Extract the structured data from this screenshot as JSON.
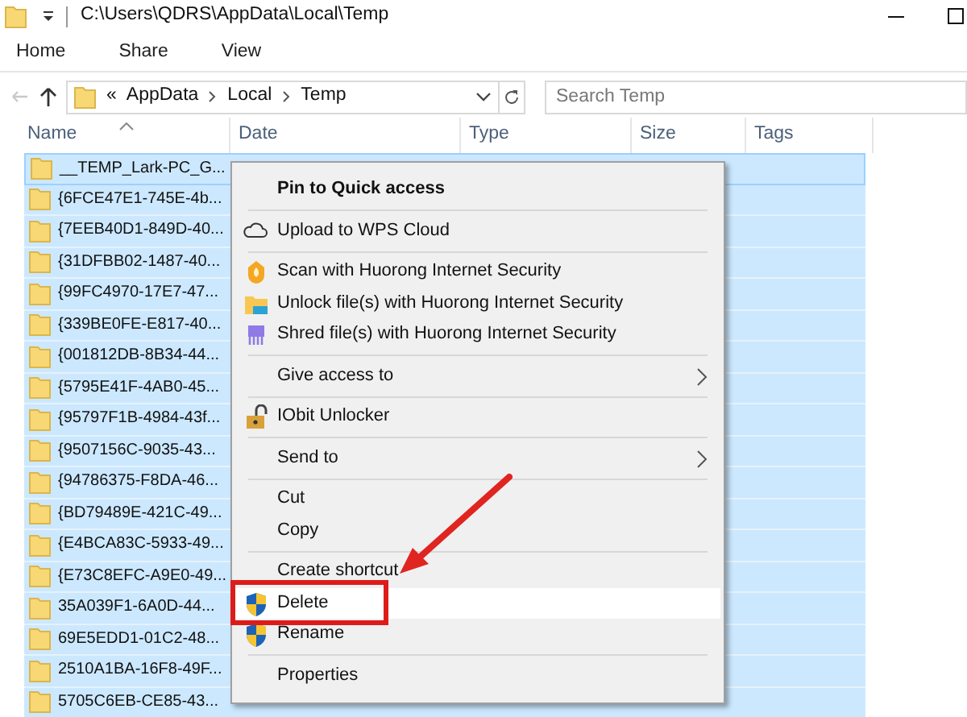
{
  "window": {
    "title": "C:\\Users\\QDRS\\AppData\\Local\\Temp"
  },
  "ribbon_tabs": [
    {
      "label": "Home"
    },
    {
      "label": "Share"
    },
    {
      "label": "View"
    }
  ],
  "address_bar": {
    "overflow": "«",
    "crumbs": [
      "AppData",
      "Local",
      "Temp"
    ]
  },
  "search": {
    "placeholder": "Search Temp"
  },
  "columns": [
    "Name",
    "Date",
    "Type",
    "Size",
    "Tags"
  ],
  "files": [
    {
      "name": "__TEMP_Lark-PC_G...",
      "selected": true
    },
    {
      "name": "{6FCE47E1-745E-4b...",
      "selected": true
    },
    {
      "name": "{7EEB40D1-849D-40...",
      "selected": true
    },
    {
      "name": "{31DFBB02-1487-40...",
      "selected": true
    },
    {
      "name": "{99FC4970-17E7-47...",
      "selected": true
    },
    {
      "name": "{339BE0FE-E817-40...",
      "selected": true
    },
    {
      "name": "{001812DB-8B34-44...",
      "selected": true
    },
    {
      "name": "{5795E41F-4AB0-45...",
      "selected": true
    },
    {
      "name": "{95797F1B-4984-43f...",
      "selected": true
    },
    {
      "name": "{9507156C-9035-43...",
      "selected": true
    },
    {
      "name": "{94786375-F8DA-46...",
      "selected": true
    },
    {
      "name": "{BD79489E-421C-49...",
      "selected": true
    },
    {
      "name": "{E4BCA83C-5933-49...",
      "selected": true
    },
    {
      "name": "{E73C8EFC-A9E0-49...",
      "selected": true
    },
    {
      "name": "35A039F1-6A0D-44...",
      "selected": true
    },
    {
      "name": "69E5EDD1-01C2-48...",
      "selected": true
    },
    {
      "name": "2510A1BA-16F8-49F...",
      "selected": true
    },
    {
      "name": "5705C6EB-CE85-43...",
      "selected": true
    }
  ],
  "context_menu": {
    "groups": [
      [
        {
          "label": "Pin to Quick access",
          "default": true,
          "submenu": false,
          "highlighted": false,
          "annotated": false
        }
      ],
      [
        {
          "label": "Upload to WPS Cloud",
          "default": false,
          "submenu": false,
          "highlighted": false,
          "annotated": false
        }
      ],
      [
        {
          "label": "Scan with Huorong Internet Security",
          "default": false,
          "submenu": false,
          "highlighted": false,
          "annotated": false
        },
        {
          "label": "Unlock file(s) with Huorong Internet Security",
          "default": false,
          "submenu": false,
          "highlighted": false,
          "annotated": false
        },
        {
          "label": "Shred file(s) with Huorong Internet Security",
          "default": false,
          "submenu": false,
          "highlighted": false,
          "annotated": false
        }
      ],
      [
        {
          "label": "Give access to",
          "default": false,
          "submenu": true,
          "highlighted": false,
          "annotated": false
        }
      ],
      [
        {
          "label": "IObit Unlocker",
          "default": false,
          "submenu": false,
          "highlighted": false,
          "annotated": false
        }
      ],
      [
        {
          "label": "Send to",
          "default": false,
          "submenu": true,
          "highlighted": false,
          "annotated": false
        }
      ],
      [
        {
          "label": "Cut",
          "default": false,
          "submenu": false,
          "highlighted": false,
          "annotated": false
        },
        {
          "label": "Copy",
          "default": false,
          "submenu": false,
          "highlighted": false,
          "annotated": false
        }
      ],
      [
        {
          "label": "Create shortcut",
          "default": false,
          "submenu": false,
          "highlighted": false,
          "annotated": false
        },
        {
          "label": "Delete",
          "default": false,
          "submenu": false,
          "highlighted": true,
          "annotated": true
        },
        {
          "label": "Rename",
          "default": false,
          "submenu": false,
          "highlighted": false,
          "annotated": false
        }
      ],
      [
        {
          "label": "Properties",
          "default": false,
          "submenu": false,
          "highlighted": false,
          "annotated": false
        }
      ]
    ]
  }
}
